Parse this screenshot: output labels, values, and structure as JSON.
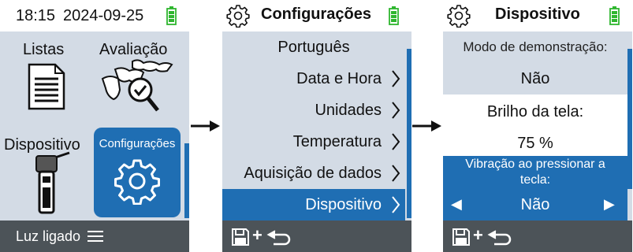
{
  "screen1": {
    "time": "18:15",
    "date": "2024-09-25",
    "tiles": [
      {
        "label": "Listas",
        "icon": "document-list-icon"
      },
      {
        "label": "Avaliação",
        "icon": "cows-check-icon"
      },
      {
        "label": "Dispositivo",
        "icon": "handheld-device-icon"
      },
      {
        "label": "Configurações",
        "icon": "gear-icon"
      }
    ],
    "footer_label": "Luz ligado",
    "footer_icon": "menu-icon"
  },
  "screen2": {
    "title": "Configurações",
    "items": [
      {
        "label": "Português"
      },
      {
        "label": "Data e Hora"
      },
      {
        "label": "Unidades"
      },
      {
        "label": "Temperatura"
      },
      {
        "label": "Aquisição de dados"
      },
      {
        "label": "Dispositivo"
      }
    ],
    "footer_icons": [
      "save-icon",
      "plus-icon",
      "back-icon"
    ]
  },
  "screen3": {
    "title": "Dispositivo",
    "settings": [
      {
        "label": "Modo de demonstração:",
        "value": "Não"
      },
      {
        "label": "Brilho da tela:",
        "value": "75 %"
      },
      {
        "label_line1": "Vibração ao pressionar a",
        "label_line2": "tecla:",
        "value": "Não"
      }
    ],
    "footer_icons": [
      "save-icon",
      "plus-icon",
      "back-icon"
    ]
  },
  "colors": {
    "accent": "#1f6eb3",
    "panel_bg": "#d3dbe5",
    "footer_bg": "#4c5358",
    "battery": "#2fb62f"
  }
}
